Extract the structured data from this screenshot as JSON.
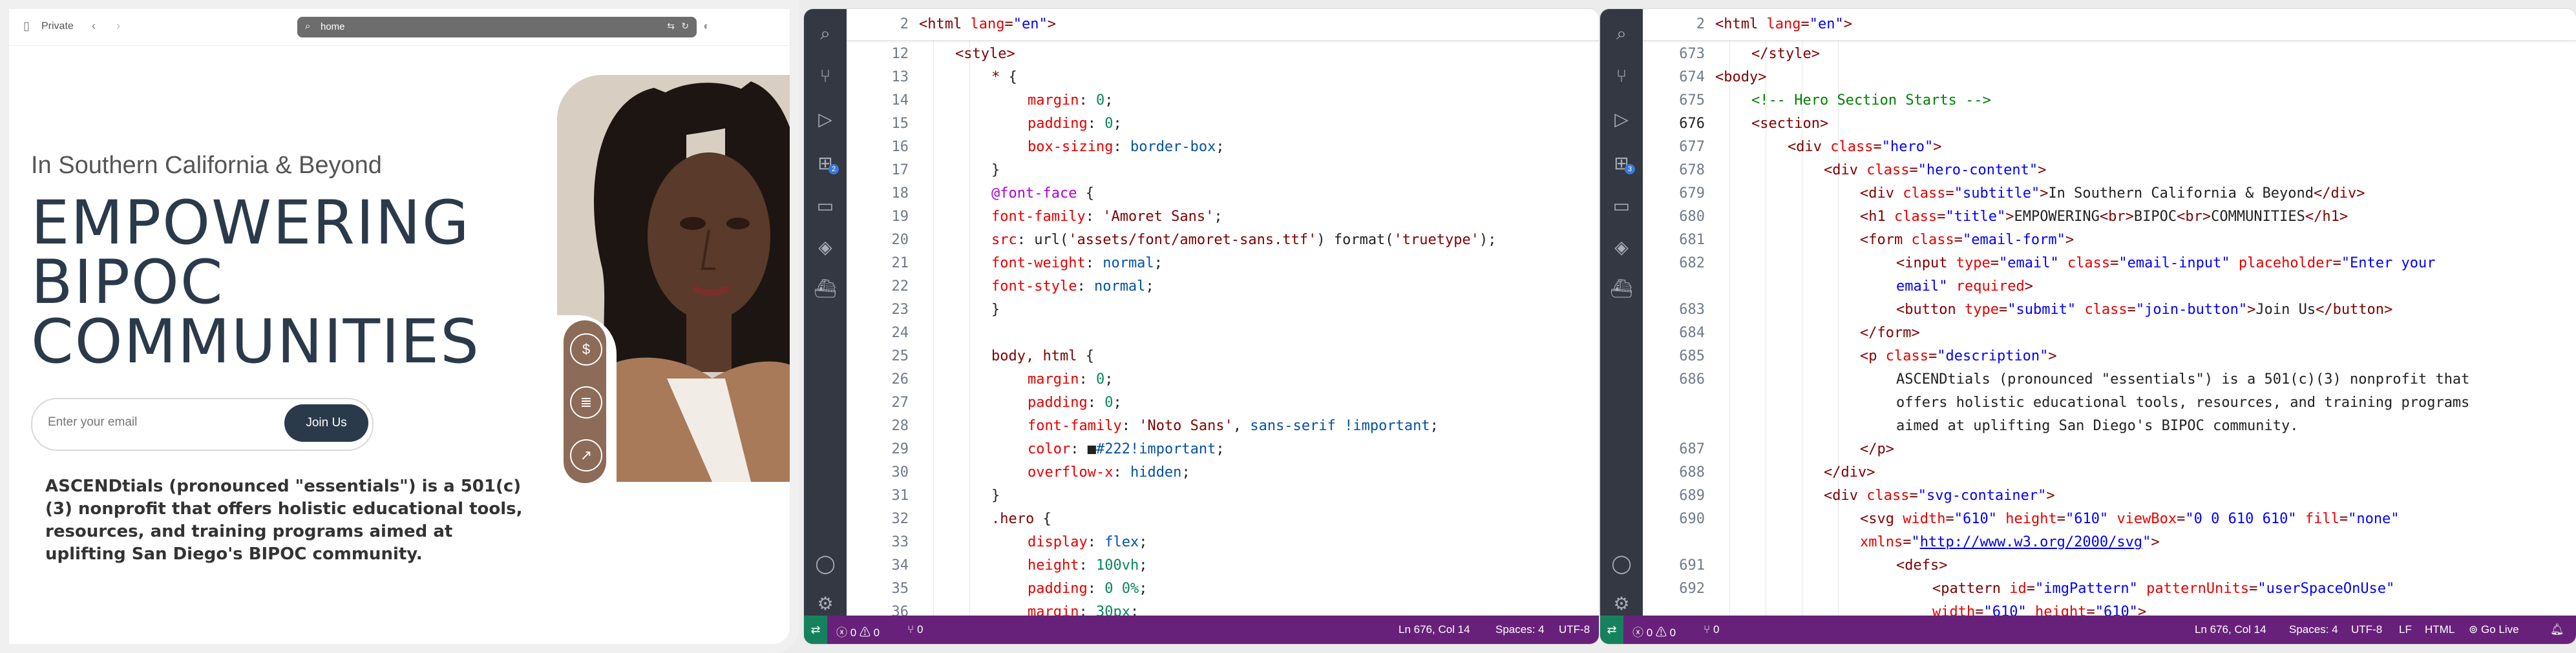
{
  "browser": {
    "private_label": "Private",
    "url": "home",
    "subtitle": "In Southern California & Beyond",
    "title_lines": [
      "EMPOWERING",
      "BIPOC",
      "COMMUNITIES"
    ],
    "email_placeholder": "Enter your email",
    "join_label": "Join Us",
    "description": "ASCENDtials (pronounced \"essentials\") is a 501(c)(3) nonprofit that offers holistic educational tools, resources, and training programs aimed at uplifting San Diego's BIPOC community."
  },
  "editor1": {
    "sticky_line": "2",
    "status": {
      "errors": "0",
      "warnings": "0",
      "ports": "0",
      "position": "Ln 676, Col 14",
      "spaces": "Spaces: 4",
      "encoding": "UTF-8"
    },
    "badge": "2"
  },
  "editor2": {
    "sticky_line": "2",
    "status": {
      "errors": "0",
      "warnings": "0",
      "ports": "0",
      "position": "Ln 676, Col 14",
      "spaces": "Spaces: 4",
      "encoding": "UTF-8",
      "eol": "LF",
      "language": "HTML",
      "golive": "Go Live"
    },
    "badge": "3"
  },
  "colors": {
    "statusbar": "#68217a",
    "activitybar": "#333843",
    "accent": "#2b3a4a"
  }
}
